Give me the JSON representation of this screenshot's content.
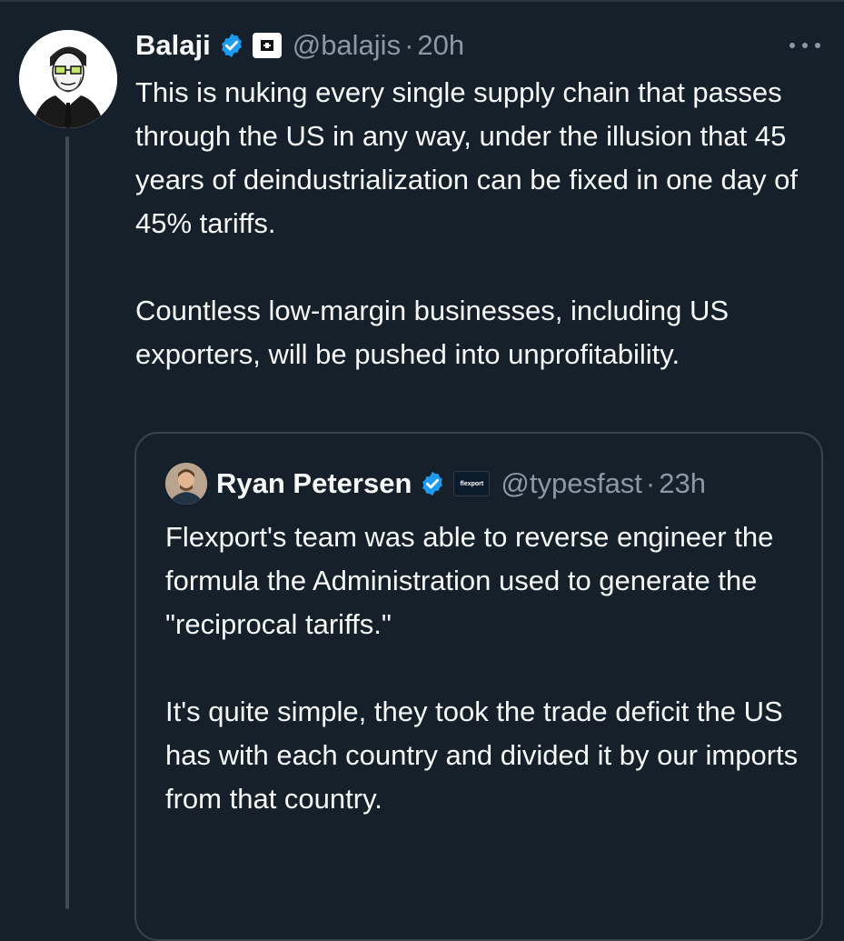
{
  "tweet": {
    "author": {
      "name": "Balaji",
      "handle": "@balajis",
      "avatar_icon": "sketch-portrait-avatar"
    },
    "separator": "·",
    "time": "20h",
    "paragraphs": [
      "This is nuking every single supply chain that passes through the US in any way, under the illusion that 45 years of deindustrialization can be fixed in one day of 45% tariffs.",
      "Countless low-margin businesses, including US exporters, will be pushed into unprofitability."
    ]
  },
  "quoted_tweet": {
    "author": {
      "name": "Ryan Petersen",
      "handle": "@typesfast",
      "affiliation_badge": "flexport"
    },
    "separator": "·",
    "time": "23h",
    "paragraphs": [
      "Flexport's team was able to reverse engineer the formula the Administration used to generate the \"reciprocal tariffs.\"",
      "It's quite simple, they took the trade deficit the US has with each country and divided it by our imports from that country."
    ]
  },
  "colors": {
    "background": "#15202b",
    "primary_text": "#f7f9f9",
    "secondary_text": "#8b98a5",
    "verified_blue": "#1d9bf0",
    "border": "#38444d"
  }
}
